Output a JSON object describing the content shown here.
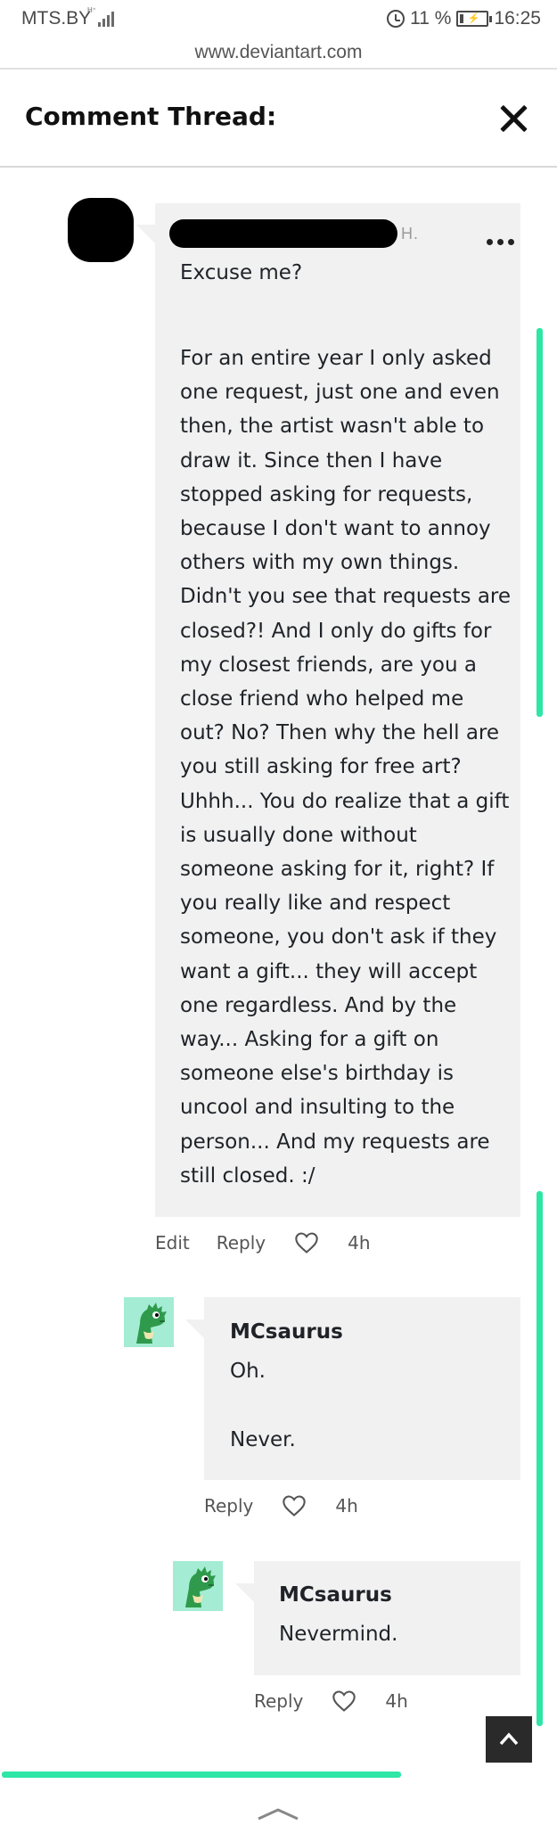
{
  "status_bar": {
    "carrier": "MTS.BY",
    "network_tag": "H⁺",
    "battery_percent": "11 %",
    "time": "16:25"
  },
  "browser": {
    "url": "www.deviantart.com"
  },
  "header": {
    "title": "Comment Thread:"
  },
  "comments": [
    {
      "author_suffix": "H.",
      "paragraphs": [
        "Excuse me?",
        "For an entire year I only asked\none request, just one and even\nthen, the artist wasn't able to\ndraw it. Since then I have\nstopped asking for requests,\nbecause I don't want to annoy\nothers with my own things.\nDidn't you see that requests are\nclosed?! And I only do gifts for\nmy closest friends, are you a\nclose friend who helped me\nout? No? Then why the hell are\nyou still asking for free art?\nUhhh... You do realize that a gift\nis usually done without\nsomeone asking for it, right? If\nyou really like and respect\nsomeone, you don't ask if they\nwant a gift... they will accept\none regardless. And by the\nway... Asking for a gift on\nsomeone else's birthday is\nuncool and insulting to the\nperson... And my requests are\nstill closed. :/"
      ],
      "actions": {
        "edit": "Edit",
        "reply": "Reply",
        "time": "4h"
      }
    },
    {
      "author": "MCsaurus",
      "paragraphs": [
        "Oh.",
        "Never."
      ],
      "actions": {
        "reply": "Reply",
        "time": "4h"
      }
    },
    {
      "author": "MCsaurus",
      "paragraphs": [
        "Nevermind."
      ],
      "actions": {
        "reply": "Reply",
        "time": "4h"
      }
    }
  ],
  "colors": {
    "accent": "#2ee6a6",
    "bubble": "#f1f1f1",
    "avatar_bg": "#a4ecd3"
  },
  "icons": [
    "alarm-icon",
    "battery-icon",
    "signal-icon",
    "close-icon",
    "more-icon",
    "heart-icon",
    "dino-avatar",
    "chevron-up-icon"
  ]
}
